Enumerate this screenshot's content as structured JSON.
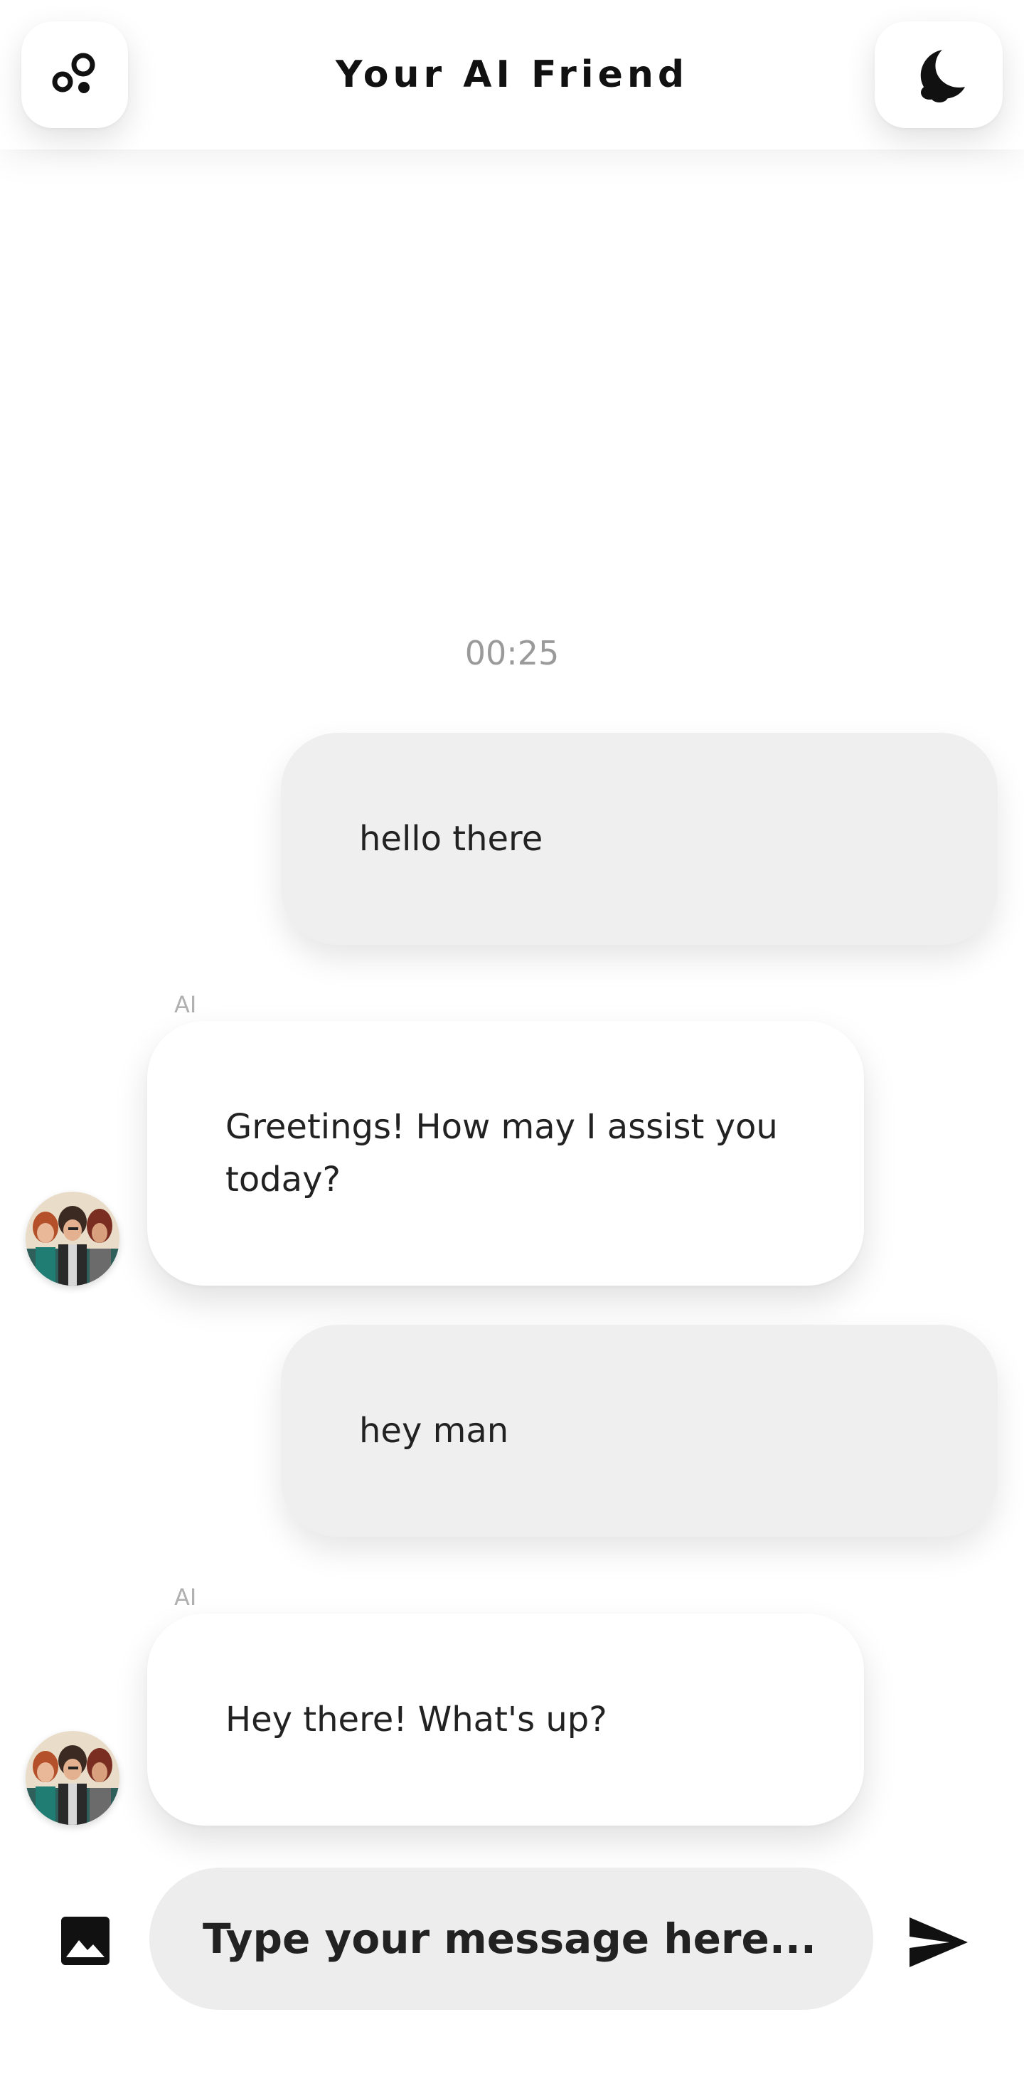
{
  "header": {
    "title": "Your AI Friend",
    "left_icon": "bubbles-icon",
    "right_icon": "moon-icon"
  },
  "chat": {
    "timestamp": "00:25",
    "messages": [
      {
        "role": "user",
        "text": "hello there"
      },
      {
        "role": "ai",
        "sender": "AI",
        "text": "Greetings! How may I assist you today?"
      },
      {
        "role": "user",
        "text": "hey man"
      },
      {
        "role": "ai",
        "sender": "AI",
        "text": "Hey there! What's up?"
      }
    ]
  },
  "composer": {
    "placeholder": "Type your message here...",
    "image_icon": "image-icon",
    "send_icon": "send-icon"
  }
}
